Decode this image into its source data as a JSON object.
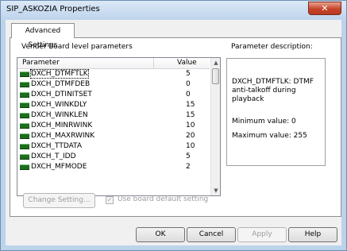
{
  "window": {
    "title": "SIP_ASKOZIA Properties",
    "close_glyph": "✕"
  },
  "tabs": [
    {
      "label": "Advanced Settings"
    }
  ],
  "params_group_label": "Vender board level parameters",
  "description_group_label": "Parameter description:",
  "list": {
    "headers": {
      "parameter": "Parameter",
      "value": "Value"
    },
    "rows": [
      {
        "name": "DXCH_DTMFTLK",
        "value": "5"
      },
      {
        "name": "DXCH_DTMFDEB",
        "value": "0"
      },
      {
        "name": "DXCH_DTINITSET",
        "value": "0"
      },
      {
        "name": "DXCH_WINKDLY",
        "value": "15"
      },
      {
        "name": "DXCH_WINKLEN",
        "value": "15"
      },
      {
        "name": "DXCH_MINRWINK",
        "value": "10"
      },
      {
        "name": "DXCH_MAXRWINK",
        "value": "20"
      },
      {
        "name": "DXCH_TTDATA",
        "value": "10"
      },
      {
        "name": "DXCH_T_IDD",
        "value": "5"
      },
      {
        "name": "DXCH_MFMODE",
        "value": "2"
      }
    ],
    "selected_index": 0
  },
  "description": {
    "text": "DXCH_DTMFTLK: DTMF anti-talkoff during playback",
    "min_label": "Minimum value:  0",
    "max_label": "Maximum value: 255"
  },
  "change_setting_label": "Change Setting...",
  "use_default_label": "Use board default setting",
  "buttons": {
    "ok": "OK",
    "cancel": "Cancel",
    "apply": "Apply",
    "help": "Help"
  }
}
